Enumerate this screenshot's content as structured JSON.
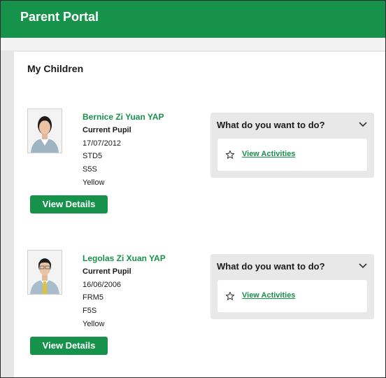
{
  "header": {
    "title": "Parent Portal"
  },
  "card": {
    "title": "My Children"
  },
  "children": [
    {
      "name": "Bernice Zi Yuan YAP",
      "status": "Current Pupil",
      "dob": "17/07/2012",
      "level": "STD5",
      "class": "S5S",
      "house": "Yellow",
      "view_button": "View Details",
      "actions_heading": "What do you want to do?",
      "action_link": "View Activities"
    },
    {
      "name": "Legolas Zi Xuan YAP",
      "status": "Current Pupil",
      "dob": "16/06/2006",
      "level": "FRM5",
      "class": "F5S",
      "house": "Yellow",
      "view_button": "View Details",
      "actions_heading": "What do you want to do?",
      "action_link": "View Activities"
    }
  ],
  "colors": {
    "brand": "#17924a",
    "panel": "#e8e8e8",
    "background": "#e6e6e6"
  },
  "icons": {
    "chevron": "chevron-down-icon",
    "star": "star-icon"
  }
}
